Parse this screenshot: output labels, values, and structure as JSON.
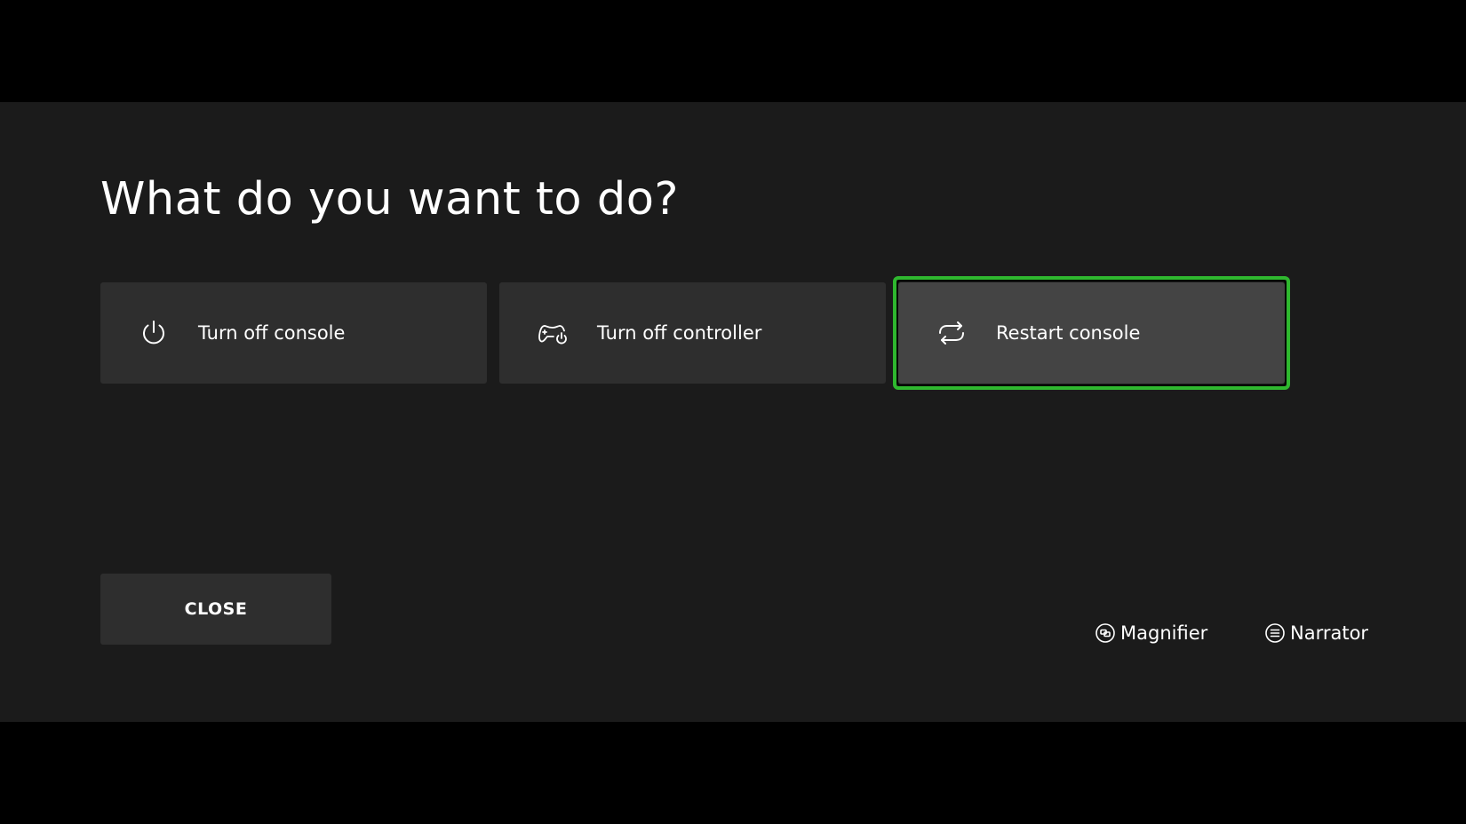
{
  "dialog": {
    "title": "What do you want to do?",
    "options": [
      {
        "label": "Turn off console",
        "icon": "power-icon"
      },
      {
        "label": "Turn off controller",
        "icon": "controller-power-icon"
      },
      {
        "label": "Restart console",
        "icon": "restart-icon",
        "focused": true
      }
    ],
    "close_label": "CLOSE"
  },
  "accessibility": {
    "magnifier_label": "Magnifier",
    "narrator_label": "Narrator"
  },
  "colors": {
    "background": "#1b1b1b",
    "letterbox": "#000000",
    "tile": "#2e2e2e",
    "tile_focused": "#444444",
    "focus_ring": "#2fb82f",
    "text": "#ffffff"
  }
}
